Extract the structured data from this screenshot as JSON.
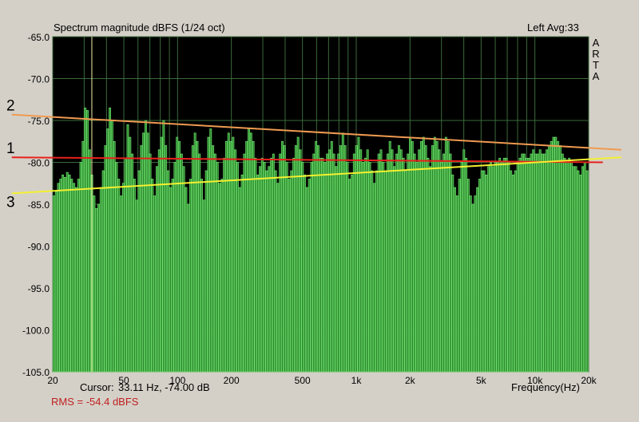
{
  "chart_data": {
    "type": "bar",
    "title": "Spectrum magnitude dBFS (1/24 oct)",
    "channel_info": "Left  Avg:33",
    "brand_vertical": [
      "A",
      "R",
      "T",
      "A"
    ],
    "xlabel": "Frequency(Hz)",
    "ylabel": "",
    "xscale": "log",
    "xlim": [
      20,
      20000
    ],
    "ylim": [
      -105,
      -65
    ],
    "grid": true,
    "y_ticks": [
      "-65.0",
      "-70.0",
      "-75.0",
      "-80.0",
      "-85.0",
      "-90.0",
      "-95.0",
      "-100.0",
      "-105.0"
    ],
    "y_tick_values": [
      -65,
      -70,
      -75,
      -80,
      -85,
      -90,
      -95,
      -100,
      -105
    ],
    "x_ticks": [
      {
        "label": "20",
        "value": 20
      },
      {
        "label": "50",
        "value": 50
      },
      {
        "label": "100",
        "value": 100
      },
      {
        "label": "200",
        "value": 200
      },
      {
        "label": "500",
        "value": 500
      },
      {
        "label": "1k",
        "value": 1000
      },
      {
        "label": "2k",
        "value": 2000
      },
      {
        "label": "5k",
        "value": 5000
      },
      {
        "label": "10k",
        "value": 10000
      },
      {
        "label": "20k",
        "value": 20000
      }
    ],
    "x_grid_values": [
      20,
      30,
      40,
      50,
      60,
      70,
      80,
      90,
      100,
      200,
      300,
      400,
      500,
      600,
      700,
      800,
      900,
      1000,
      2000,
      3000,
      4000,
      5000,
      6000,
      7000,
      8000,
      9000,
      10000,
      20000
    ],
    "bands_per_octave": 24,
    "start_freq": 20,
    "values": [
      -84,
      -83.5,
      -82.5,
      -82,
      -81.5,
      -81.8,
      -81.2,
      -81.5,
      -82,
      -82.5,
      -83,
      -82,
      -80,
      -77.5,
      -73.5,
      -73.8,
      -78.5,
      -81.5,
      -84,
      -85.5,
      -85,
      -83,
      -81,
      -78,
      -76,
      -73.5,
      -75,
      -77.5,
      -80,
      -82,
      -84,
      -82.5,
      -79.5,
      -75.5,
      -77,
      -79,
      -82,
      -84.5,
      -81,
      -78,
      -76.5,
      -75,
      -76.5,
      -79,
      -82,
      -84,
      -80.5,
      -78.5,
      -77,
      -75,
      -78,
      -81,
      -83,
      -82,
      -80,
      -77,
      -77.5,
      -79,
      -80.5,
      -83,
      -85,
      -82,
      -78,
      -76.5,
      -77.5,
      -79,
      -82,
      -84.5,
      -81,
      -77,
      -76,
      -78,
      -79,
      -80,
      -82.5,
      -82,
      -79.5,
      -77.5,
      -76.5,
      -77.5,
      -77,
      -78.5,
      -80,
      -83,
      -81.5,
      -79,
      -77.5,
      -76,
      -76.5,
      -77.5,
      -79.5,
      -81.5,
      -80.5,
      -79.5,
      -80,
      -81,
      -80.5,
      -79.5,
      -79,
      -81,
      -82.5,
      -79,
      -77.5,
      -78,
      -80,
      -82,
      -81,
      -79.5,
      -78,
      -77,
      -78.5,
      -80,
      -81.5,
      -83,
      -82,
      -80,
      -79,
      -77.5,
      -78,
      -79.5,
      -79.5,
      -80,
      -79,
      -78.5,
      -77.5,
      -79,
      -80.5,
      -79,
      -78,
      -76.5,
      -78,
      -80,
      -82,
      -81.5,
      -79,
      -78,
      -77,
      -78.5,
      -80,
      -79.5,
      -78.5,
      -80,
      -81,
      -82.5,
      -81,
      -79,
      -78.5,
      -80,
      -81,
      -79,
      -77.5,
      -78.5,
      -80.5,
      -79,
      -78,
      -78.5,
      -79.5,
      -81,
      -79,
      -77,
      -77.5,
      -79,
      -80,
      -78.5,
      -77.5,
      -77,
      -78,
      -79.5,
      -80.5,
      -78,
      -77,
      -77.5,
      -78.5,
      -80,
      -79,
      -77,
      -77.5,
      -79,
      -81.5,
      -83,
      -84,
      -82,
      -80,
      -78.5,
      -79.5,
      -82,
      -84,
      -85,
      -84,
      -83,
      -82,
      -81,
      -81,
      -81.5,
      -80.5,
      -80,
      -80.5,
      -80,
      -80,
      -79.5,
      -80,
      -79.5,
      -79.5,
      -80,
      -81,
      -81.5,
      -81,
      -80,
      -79.5,
      -79,
      -79,
      -79.5,
      -79.5,
      -79,
      -78.5,
      -79,
      -79,
      -78.5,
      -79,
      -79,
      -78.5,
      -78,
      -77.5,
      -77,
      -77,
      -77.5,
      -78,
      -79,
      -79.5,
      -80,
      -79.5,
      -80,
      -80.5,
      -80.5,
      -81,
      -81.5,
      -80.5,
      -80,
      -81
    ],
    "overlay_lines": [
      {
        "label": "1",
        "color": "#e8201c",
        "from": {
          "freq": 11.8,
          "db": -79.4
        },
        "to": {
          "freq": 24000,
          "db": -80.0
        }
      },
      {
        "label": "2",
        "color": "#f09a50",
        "from": {
          "freq": 11.8,
          "db": -74.3
        },
        "to": {
          "freq": 30500,
          "db": -78.5
        }
      },
      {
        "label": "3",
        "color": "#f4f030",
        "from": {
          "freq": 11.8,
          "db": -83.7
        },
        "to": {
          "freq": 30500,
          "db": -79.4
        }
      }
    ],
    "cursor": {
      "freq": 33.11,
      "db": -74.0
    }
  },
  "footer": {
    "cursor_label": "Cursor:",
    "cursor_value": "33.11 Hz, -74.00 dB",
    "rms": "RMS =  -54.4 dBFS"
  },
  "colors": {
    "bar_fill": "#2c8a2c",
    "bar_edge": "#6ee06e",
    "grid": "#3a6a3a",
    "plot_bg": "#000000",
    "rms": "#c02020"
  }
}
